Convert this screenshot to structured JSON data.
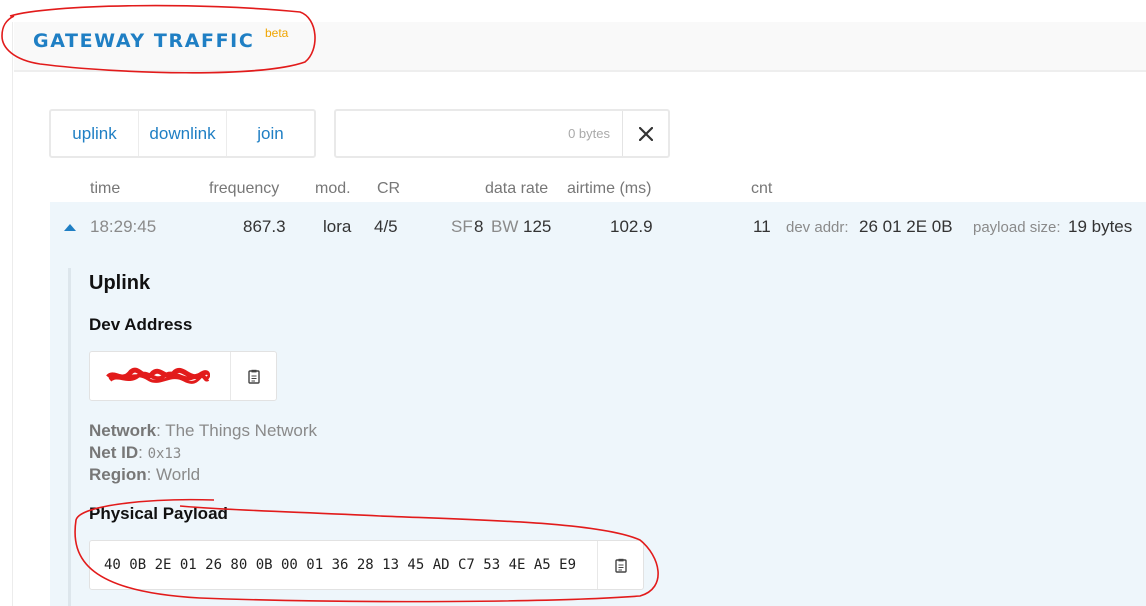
{
  "header": {
    "title": "GATEWAY TRAFFIC",
    "badge": "beta"
  },
  "filters": {
    "uplink": "uplink",
    "downlink": "downlink",
    "join": "join"
  },
  "search": {
    "placeholder": "0 bytes",
    "value": ""
  },
  "columns": {
    "time": "time",
    "frequency": "frequency",
    "mod": "mod.",
    "cr": "CR",
    "data_rate": "data rate",
    "airtime": "airtime (ms)",
    "cnt": "cnt"
  },
  "row": {
    "time": "18:29:45",
    "frequency": "867.3",
    "mod": "lora",
    "cr": "4/5",
    "sf_label": "SF",
    "sf_value": "8",
    "bw_label": "BW",
    "bw_value": "125",
    "airtime": "102.9",
    "cnt": "11",
    "dev_addr_label": "dev addr:",
    "dev_addr": "26 01 2E 0B",
    "payload_size_label": "payload size:",
    "payload_size": "19 bytes"
  },
  "detail": {
    "heading": "Uplink",
    "dev_address_heading": "Dev Address",
    "network_label": "Network",
    "network_value": ": The Things Network",
    "netid_label": "Net ID",
    "netid_sep": ": ",
    "netid_value": "0x13",
    "region_label": "Region",
    "region_value": ": World",
    "physical_payload_heading": "Physical Payload",
    "physical_payload": "40 0B 2E 01 26 80 0B 00 01 36 28 13 45 AD C7 53 4E A5 E9"
  },
  "icons": {
    "close": "close-icon",
    "copy": "clipboard-icon",
    "expand": "caret-up-icon"
  },
  "colors": {
    "accent": "#1f7fc4",
    "badge": "#f0a500",
    "annotation": "#e21b1b",
    "panel": "#eef6fb"
  }
}
